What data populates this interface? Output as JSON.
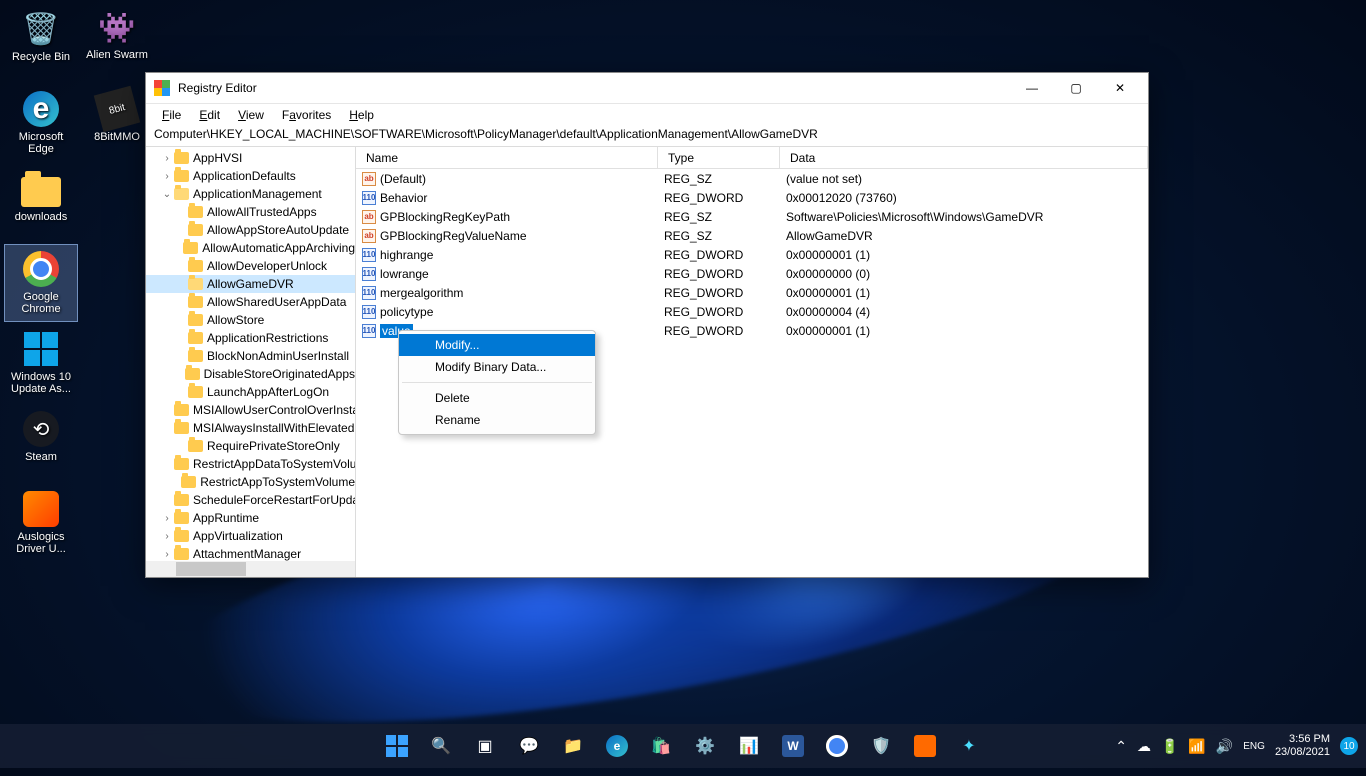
{
  "desktop": {
    "icons": [
      {
        "label": "Recycle Bin"
      },
      {
        "label": "Alien Swarm"
      },
      {
        "label": "Microsoft Edge"
      },
      {
        "label": "8BitMMO"
      },
      {
        "label": "downloads"
      },
      {
        "label": "Google Chrome"
      },
      {
        "label": "Windows 10 Update As..."
      },
      {
        "label": "Steam"
      },
      {
        "label": "Auslogics Driver U..."
      }
    ]
  },
  "window": {
    "title": "Registry Editor",
    "menubar": [
      "File",
      "Edit",
      "View",
      "Favorites",
      "Help"
    ],
    "address": "Computer\\HKEY_LOCAL_MACHINE\\SOFTWARE\\Microsoft\\PolicyManager\\default\\ApplicationManagement\\AllowGameDVR",
    "tree": [
      {
        "level": 1,
        "exp": ">",
        "label": "AppHVSI"
      },
      {
        "level": 1,
        "exp": ">",
        "label": "ApplicationDefaults"
      },
      {
        "level": 1,
        "exp": "v",
        "label": "ApplicationManagement",
        "open": true
      },
      {
        "level": 2,
        "exp": "",
        "label": "AllowAllTrustedApps"
      },
      {
        "level": 2,
        "exp": "",
        "label": "AllowAppStoreAutoUpdate"
      },
      {
        "level": 2,
        "exp": "",
        "label": "AllowAutomaticAppArchiving"
      },
      {
        "level": 2,
        "exp": "",
        "label": "AllowDeveloperUnlock"
      },
      {
        "level": 2,
        "exp": "",
        "label": "AllowGameDVR",
        "selected": true,
        "open": true
      },
      {
        "level": 2,
        "exp": "",
        "label": "AllowSharedUserAppData"
      },
      {
        "level": 2,
        "exp": "",
        "label": "AllowStore"
      },
      {
        "level": 2,
        "exp": "",
        "label": "ApplicationRestrictions"
      },
      {
        "level": 2,
        "exp": "",
        "label": "BlockNonAdminUserInstall"
      },
      {
        "level": 2,
        "exp": "",
        "label": "DisableStoreOriginatedApps"
      },
      {
        "level": 2,
        "exp": "",
        "label": "LaunchAppAfterLogOn"
      },
      {
        "level": 2,
        "exp": "",
        "label": "MSIAllowUserControlOverInstall"
      },
      {
        "level": 2,
        "exp": "",
        "label": "MSIAlwaysInstallWithElevatedPrivileges"
      },
      {
        "level": 2,
        "exp": "",
        "label": "RequirePrivateStoreOnly"
      },
      {
        "level": 2,
        "exp": "",
        "label": "RestrictAppDataToSystemVolume"
      },
      {
        "level": 2,
        "exp": "",
        "label": "RestrictAppToSystemVolume"
      },
      {
        "level": 2,
        "exp": "",
        "label": "ScheduleForceRestartForUpdateFailures"
      },
      {
        "level": 1,
        "exp": ">",
        "label": "AppRuntime"
      },
      {
        "level": 1,
        "exp": ">",
        "label": "AppVirtualization"
      },
      {
        "level": 1,
        "exp": ">",
        "label": "AttachmentManager"
      }
    ],
    "columns": {
      "name": "Name",
      "type": "Type",
      "data": "Data"
    },
    "values": [
      {
        "icon": "sz",
        "name": "(Default)",
        "type": "REG_SZ",
        "data": "(value not set)"
      },
      {
        "icon": "dw",
        "name": "Behavior",
        "type": "REG_DWORD",
        "data": "0x00012020 (73760)"
      },
      {
        "icon": "sz",
        "name": "GPBlockingRegKeyPath",
        "type": "REG_SZ",
        "data": "Software\\Policies\\Microsoft\\Windows\\GameDVR"
      },
      {
        "icon": "sz",
        "name": "GPBlockingRegValueName",
        "type": "REG_SZ",
        "data": "AllowGameDVR"
      },
      {
        "icon": "dw",
        "name": "highrange",
        "type": "REG_DWORD",
        "data": "0x00000001 (1)"
      },
      {
        "icon": "dw",
        "name": "lowrange",
        "type": "REG_DWORD",
        "data": "0x00000000 (0)"
      },
      {
        "icon": "dw",
        "name": "mergealgorithm",
        "type": "REG_DWORD",
        "data": "0x00000001 (1)"
      },
      {
        "icon": "dw",
        "name": "policytype",
        "type": "REG_DWORD",
        "data": "0x00000004 (4)"
      },
      {
        "icon": "dw",
        "name": "value",
        "type": "REG_DWORD",
        "data": "0x00000001 (1)",
        "selected": true
      }
    ],
    "context_menu": {
      "items": [
        {
          "label": "Modify...",
          "highlight": true
        },
        {
          "label": "Modify Binary Data..."
        },
        {
          "sep": true
        },
        {
          "label": "Delete"
        },
        {
          "label": "Rename"
        }
      ]
    }
  },
  "taskbar": {
    "apps": [
      "start",
      "search",
      "taskview",
      "chat",
      "explorer",
      "edge",
      "store",
      "settings",
      "analytics",
      "word",
      "chrome",
      "security",
      "monitor",
      "assistant"
    ],
    "systray": {
      "chevron_icon": "⌃",
      "onedrive_icon": "☁",
      "battery_icon": "🔋",
      "wifi_icon": "📶",
      "volume_icon": "🔊",
      "ime_icon": "ENG"
    },
    "clock": {
      "time": "3:56 PM",
      "date": "23/08/2021"
    },
    "notification_count": "10"
  }
}
